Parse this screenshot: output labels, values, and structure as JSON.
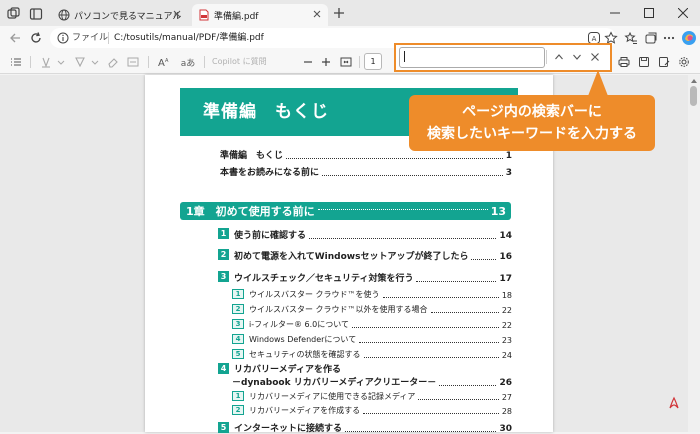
{
  "browser": {
    "tabs": [
      {
        "title": "パソコンで見るマニュアル",
        "active": false
      },
      {
        "title": "準備編.pdf",
        "active": true
      }
    ],
    "address": {
      "scheme_label": "ファイル",
      "path": "C:/tosutils/manual/PDF/準備編.pdf"
    }
  },
  "pdf_toolbar": {
    "copilot_placeholder": "Copilot に質問",
    "page_number": "1",
    "read_aloud_label": "aあ"
  },
  "find_bar": {
    "value": ""
  },
  "document": {
    "heading": "準備編　もくじ",
    "intro_rows": [
      {
        "label": "準備編　もくじ",
        "page": "1"
      },
      {
        "label": "本書をお読みになる前に",
        "page": "3"
      }
    ],
    "chapter1": {
      "label": "1章　初めて使用する前に",
      "page": "13"
    },
    "sections": [
      {
        "num": "1",
        "label": "使う前に確認する",
        "page": "14"
      },
      {
        "num": "2",
        "label": "初めて電源を入れてWindowsセットアップが終了したら",
        "page": "16"
      },
      {
        "num": "3",
        "label": "ウイルスチェック／セキュリティ対策を行う",
        "page": "17"
      },
      {
        "num": "4",
        "label": "リカバリーメディアを作る",
        "label2": "－dynabook リカバリーメディアクリエーター－",
        "page": "26"
      },
      {
        "num": "5",
        "label": "インターネットに接続する",
        "page": "30"
      }
    ],
    "sub3": [
      {
        "num": "1",
        "label": "ウイルスバスター クラウド™を使う",
        "page": "18"
      },
      {
        "num": "2",
        "label": "ウイルスバスター クラウド™以外を使用する場合",
        "page": "22"
      },
      {
        "num": "3",
        "label": "i-フィルター® 6.0について",
        "page": "22"
      },
      {
        "num": "4",
        "label": "Windows Defenderについて",
        "page": "23"
      },
      {
        "num": "5",
        "label": "セキュリティの状態を確認する",
        "page": "24"
      }
    ],
    "sub4": [
      {
        "num": "1",
        "label": "リカバリーメディアに使用できる記録メディア",
        "page": "27"
      },
      {
        "num": "2",
        "label": "リカバリーメディアを作成する",
        "page": "28"
      }
    ]
  },
  "callout": {
    "line1": "ページ内の検索バーに",
    "line2": "検索したいキーワードを入力する"
  },
  "colors": {
    "accent": "#13a491",
    "callout": "#ee8c2a"
  }
}
